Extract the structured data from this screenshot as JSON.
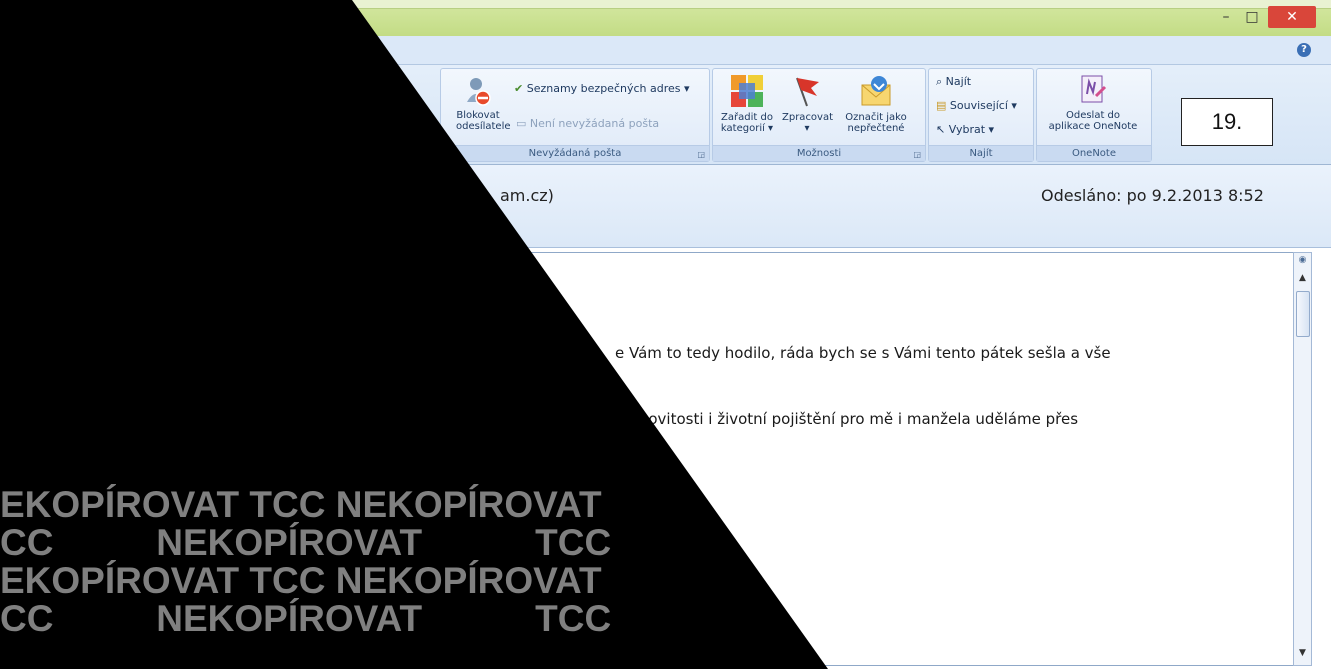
{
  "window": {
    "minimize_icon": "minimize-icon",
    "maximize_icon": "maximize-icon",
    "close_icon": "close-icon",
    "min_glyph": "–",
    "max_glyph": "□",
    "close_glyph": "✕"
  },
  "ribbon": {
    "junk_group": {
      "block_sender": "Blokovat\nodesílatele",
      "safe_lists": "Seznamy bezpečných adres ▾",
      "not_junk": "Není nevyžádaná pošta",
      "label": "Nevyžádaná pošta"
    },
    "options_group": {
      "categorize": "Zařadit do\nkategorií ▾",
      "follow_up": "Zpracovat\n▾",
      "mark_unread": "Označit jako\nnepřečtené",
      "label": "Možnosti"
    },
    "find_group": {
      "find": "Najít",
      "related": "Související ▾",
      "select": "Vybrat ▾",
      "label": "Najít"
    },
    "onenote_group": {
      "send_onenote": "Odeslat do\naplikace OneNote",
      "label": "OneNote"
    },
    "badge": "19."
  },
  "header": {
    "from_fragment": "am.cz)",
    "sent": "Odesláno: po 9.2.2013 8:52"
  },
  "message": {
    "line1": "e Vám to tedy hodilo, ráda bych se s Vámi tento pátek sešla a vše",
    "line2": "nemovitosti i životní pojištění pro mě i manžela uděláme přes"
  },
  "watermark": {
    "line1": "EKOPÍROVAT TCC NEKOPÍROVAT",
    "line2": "CC          NEKOPÍROVAT           TCC",
    "line3": "EKOPÍROVAT TCC NEKOPÍROVAT",
    "line4": "CC          NEKOPÍROVAT           TCC"
  },
  "colors": {
    "close_button": "#d9463a",
    "titlebar": "#c8df8e",
    "ribbon": "#dce9f8",
    "overlay": "#000000",
    "watermark": "#808080"
  }
}
